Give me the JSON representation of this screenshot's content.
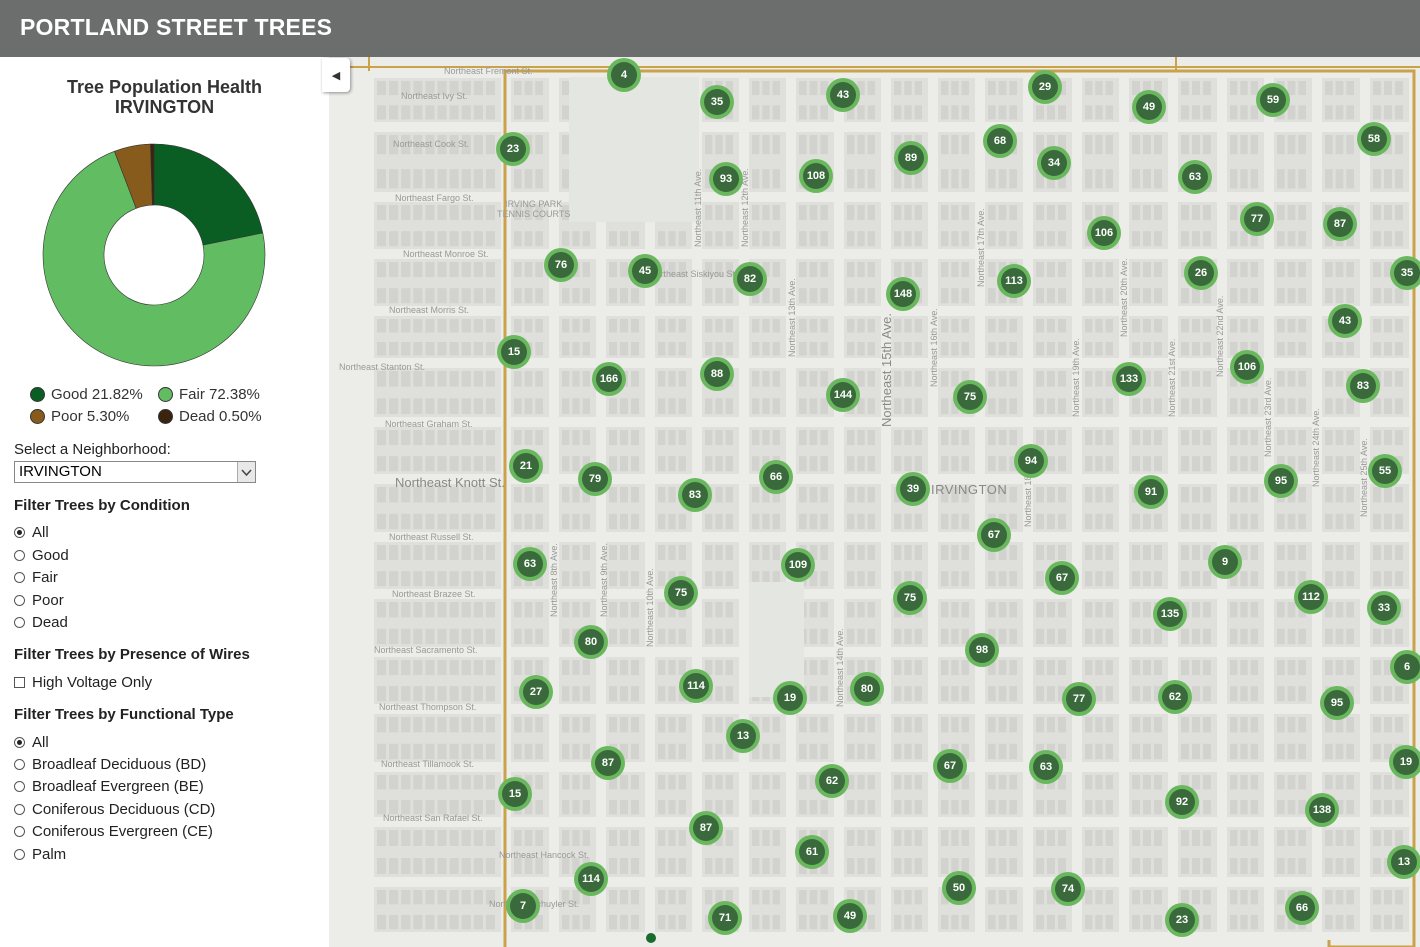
{
  "header": {
    "title": "PORTLAND STREET TREES"
  },
  "chart": {
    "title_line1": "Tree Population Health",
    "title_line2": "IRVINGTON",
    "chart_data": {
      "type": "pie",
      "categories": [
        "Good",
        "Fair",
        "Poor",
        "Dead"
      ],
      "values": [
        21.82,
        72.38,
        5.3,
        0.5
      ],
      "colors": [
        "#0b5e23",
        "#62bd62",
        "#875b1c",
        "#3a2410"
      ]
    },
    "legend": [
      {
        "label": "Good 21.82%",
        "color": "#0b5e23"
      },
      {
        "label": "Fair 72.38%",
        "color": "#62bd62"
      },
      {
        "label": "Poor 5.30%",
        "color": "#875b1c"
      },
      {
        "label": "Dead 0.50%",
        "color": "#3a2410"
      }
    ]
  },
  "neighborhood": {
    "label": "Select a Neighborhood:",
    "value": "IRVINGTON"
  },
  "condition_filter": {
    "label": "Filter Trees by Condition",
    "options": [
      "All",
      "Good",
      "Fair",
      "Poor",
      "Dead"
    ],
    "selected": "All"
  },
  "wires_filter": {
    "label": "Filter Trees by Presence of Wires",
    "checkbox": "High Voltage Only"
  },
  "type_filter": {
    "label": "Filter Trees by Functional Type",
    "options": [
      "All",
      "Broadleaf Deciduous (BD)",
      "Broadleaf Evergreen (BE)",
      "Coniferous Deciduous (CD)",
      "Coniferous Evergreen (CE)",
      "Palm"
    ],
    "selected": "All"
  },
  "map": {
    "collapse_icon": "◀",
    "neighborhood_label": "IRVINGTON",
    "park_label_1": "IRVING PARK",
    "park_label_2": "TENNIS COURTS",
    "streets_h": [
      {
        "text": "Northeast Fremont St."
      },
      {
        "text": "Northeast Ivy St."
      },
      {
        "text": "Northeast Cook St."
      },
      {
        "text": "Northeast Fargo St."
      },
      {
        "text": "Northeast Monroe St."
      },
      {
        "text": "Northeast Siskiyou St."
      },
      {
        "text": "Northeast Morris St."
      },
      {
        "text": "Northeast Stanton St."
      },
      {
        "text": "Northeast Graham St."
      },
      {
        "text": "Northeast Knott St."
      },
      {
        "text": "Northeast Russell St."
      },
      {
        "text": "Northeast Brazee St."
      },
      {
        "text": "Northeast Sacramento St."
      },
      {
        "text": "Northeast Thompson St."
      },
      {
        "text": "Northeast Tillamook St."
      },
      {
        "text": "Northeast San Rafael St."
      },
      {
        "text": "Northeast Hancock St."
      },
      {
        "text": "Northeast Schuyler St."
      }
    ],
    "streets_v": [
      {
        "text": "Northeast 8th Ave."
      },
      {
        "text": "Northeast 9th Ave."
      },
      {
        "text": "Northeast 10th Ave."
      },
      {
        "text": "Northeast 11th Ave."
      },
      {
        "text": "Northeast 12th Ave."
      },
      {
        "text": "Northeast 13th Ave."
      },
      {
        "text": "Northeast 14th Ave."
      },
      {
        "text": "Northeast 15th Ave."
      },
      {
        "text": "Northeast 16th Ave."
      },
      {
        "text": "Northeast 17th Ave."
      },
      {
        "text": "Northeast 18th Ave."
      },
      {
        "text": "Northeast 19th Ave."
      },
      {
        "text": "Northeast 20th Ave."
      },
      {
        "text": "Northeast 21st Ave."
      },
      {
        "text": "Northeast 22nd Ave."
      },
      {
        "text": "Northeast 23rd Ave."
      },
      {
        "text": "Northeast 24th Ave."
      },
      {
        "text": "Northeast 25th Ave."
      }
    ],
    "clusters": [
      {
        "count": "4"
      },
      {
        "count": "35"
      },
      {
        "count": "43"
      },
      {
        "count": "29"
      },
      {
        "count": "49"
      },
      {
        "count": "59"
      },
      {
        "count": "23"
      },
      {
        "count": "68"
      },
      {
        "count": "58"
      },
      {
        "count": "93"
      },
      {
        "count": "108"
      },
      {
        "count": "89"
      },
      {
        "count": "34"
      },
      {
        "count": "63"
      },
      {
        "count": "77"
      },
      {
        "count": "87"
      },
      {
        "count": "106"
      },
      {
        "count": "76"
      },
      {
        "count": "45"
      },
      {
        "count": "82"
      },
      {
        "count": "113"
      },
      {
        "count": "26"
      },
      {
        "count": "35"
      },
      {
        "count": "148"
      },
      {
        "count": "43"
      },
      {
        "count": "15"
      },
      {
        "count": "166"
      },
      {
        "count": "88"
      },
      {
        "count": "106"
      },
      {
        "count": "144"
      },
      {
        "count": "75"
      },
      {
        "count": "133"
      },
      {
        "count": "83"
      },
      {
        "count": "94"
      },
      {
        "count": "21"
      },
      {
        "count": "79"
      },
      {
        "count": "66"
      },
      {
        "count": "83"
      },
      {
        "count": "39"
      },
      {
        "count": "91"
      },
      {
        "count": "95"
      },
      {
        "count": "55"
      },
      {
        "count": "67"
      },
      {
        "count": "63"
      },
      {
        "count": "109"
      },
      {
        "count": "9"
      },
      {
        "count": "67"
      },
      {
        "count": "75"
      },
      {
        "count": "75"
      },
      {
        "count": "112"
      },
      {
        "count": "135"
      },
      {
        "count": "33"
      },
      {
        "count": "80"
      },
      {
        "count": "98"
      },
      {
        "count": "6"
      },
      {
        "count": "27"
      },
      {
        "count": "114"
      },
      {
        "count": "19"
      },
      {
        "count": "80"
      },
      {
        "count": "77"
      },
      {
        "count": "62"
      },
      {
        "count": "95"
      },
      {
        "count": "13"
      },
      {
        "count": "87"
      },
      {
        "count": "67"
      },
      {
        "count": "63"
      },
      {
        "count": "19"
      },
      {
        "count": "62"
      },
      {
        "count": "15"
      },
      {
        "count": "92"
      },
      {
        "count": "138"
      },
      {
        "count": "87"
      },
      {
        "count": "61"
      },
      {
        "count": "13"
      },
      {
        "count": "114"
      },
      {
        "count": "50"
      },
      {
        "count": "74"
      },
      {
        "count": "7"
      },
      {
        "count": "71"
      },
      {
        "count": "49"
      },
      {
        "count": "23"
      },
      {
        "count": "66"
      }
    ]
  }
}
